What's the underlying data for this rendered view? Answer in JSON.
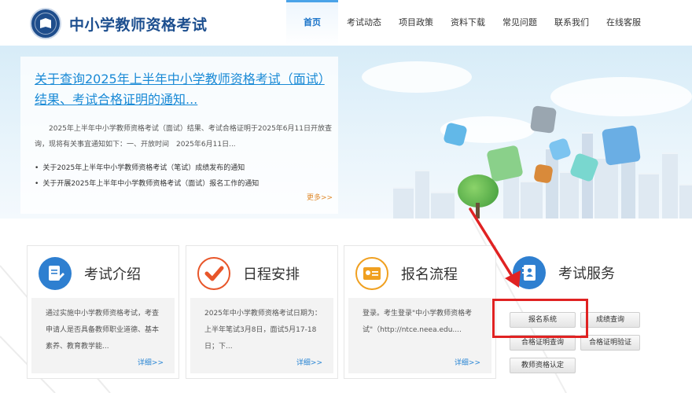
{
  "header": {
    "site_title": "中小学教师资格考试",
    "logo_icon": "education-emblem-icon",
    "nav": [
      {
        "label": "首页",
        "active": true
      },
      {
        "label": "考试动态",
        "active": false
      },
      {
        "label": "项目政策",
        "active": false
      },
      {
        "label": "资料下载",
        "active": false
      },
      {
        "label": "常见问题",
        "active": false
      },
      {
        "label": "联系我们",
        "active": false
      },
      {
        "label": "在线客服",
        "active": false
      }
    ]
  },
  "banner": {
    "headline": "关于查询2025年上半年中小学教师资格考试（面试）结果、考试合格证明的通知...",
    "summary": "2025年上半年中小学教师资格考试（面试）结果、考试合格证明于2025年6月11日开放查询，现将有关事宜通知如下：一、开放时间　2025年6月11日...",
    "bullets": [
      "关于2025年上半年中小学教师资格考试（笔试）成绩发布的通知",
      "关于开展2025年上半年中小学教师资格考试（面试）报名工作的通知"
    ],
    "more": "更多>>"
  },
  "cards": [
    {
      "icon": "document-pen-icon",
      "title": "考试介绍",
      "text": "通过实施中小学教师资格考试，考查申请人是否具备教师职业道德、基本素养、教育教学能...",
      "link": "详细>>",
      "color": "#2e7fd0"
    },
    {
      "icon": "checkmark-icon",
      "title": "日程安排",
      "text": "2025年中小学教师资格考试日期为：上半年笔试3月8日，面试5月17-18日；下...",
      "link": "详细>>",
      "color": "#e8562a"
    },
    {
      "icon": "id-card-icon",
      "title": "报名流程",
      "text": "登录。考生登录\"中小学教师资格考试\"（http://ntce.neea.edu....",
      "link": "详细>>",
      "color": "#f0a020"
    },
    {
      "icon": "contact-book-icon",
      "title": "考试服务",
      "color": "#2e7fd0"
    }
  ],
  "services": [
    "报名系统",
    "成绩查询",
    "合格证明查询",
    "合格证明验证",
    "教师资格认定"
  ],
  "colors": {
    "brand": "#1d4f8f",
    "link": "#1a8ad6",
    "annotation": "#e02222"
  }
}
